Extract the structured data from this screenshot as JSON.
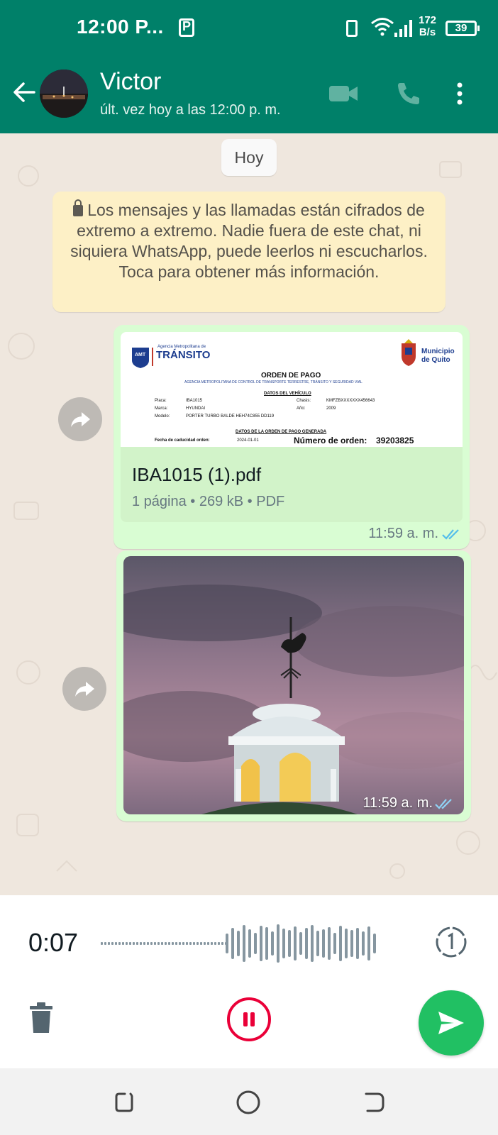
{
  "status_bar": {
    "time": "12:00 P...",
    "net_rate_value": "172",
    "net_rate_unit": "B/s",
    "battery": "39",
    "icons": [
      "p-app-icon",
      "vibrate-icon",
      "wifi-icon",
      "signal-icon",
      "battery-icon"
    ]
  },
  "header": {
    "contact_name": "Victor",
    "last_seen": "últ. vez hoy a las 12:00 p. m.",
    "icons": [
      "back-arrow-icon",
      "video-call-icon",
      "voice-call-icon",
      "more-options-icon"
    ]
  },
  "chat": {
    "date_chip": "Hoy",
    "encryption_notice": "Los mensajes y las llamadas están cifrados de extremo a extremo. Nadie fuera de este chat, ni siquiera WhatsApp, puede leerlos ni escucharlos. Toca para obtener más información.",
    "messages": [
      {
        "type": "document",
        "file_name": "IBA1015 (1).pdf",
        "meta": "1 página • 269 kB • PDF",
        "time": "11:59 a. m.",
        "status": "read",
        "preview": {
          "agency_small": "Agencia Metropolitana de",
          "agency_big": "TRÁNSITO",
          "municipio_line1": "Municipio",
          "municipio_line2": "de Quito",
          "title": "ORDEN DE PAGO",
          "subtitle": "AGENCIA METROPOLITANA DE CONTROL DE TRANSPORTE TERRESTRE, TRÁNSITO Y SEGURIDAD VIAL",
          "section_vehicle": "DATOS DEL VEHÍCULO",
          "placa_label": "Placa:",
          "placa": "IBA1015",
          "chasis_label": "Chasis:",
          "chasis": "KMFZBXXXXXXX456643",
          "marca_label": "Marca:",
          "marca": "HYUNDAI",
          "anio_label": "Año:",
          "anio": "2009",
          "modelo_label": "Modelo:",
          "modelo": "PORTER TURBO BALDE HEH74C855 DD119",
          "section_order": "DATOS DE LA ORDEN DE PAGO GENERADA",
          "caducidad_label": "Fecha de caducidad orden:",
          "caducidad": "2024-01-01",
          "orden_label": "Número de orden:",
          "orden": "39203825"
        }
      },
      {
        "type": "image",
        "description": "weathervane-dome-photo",
        "time": "11:59 a. m.",
        "status": "read"
      }
    ]
  },
  "recorder": {
    "elapsed": "0:07",
    "icons": [
      "view-once-icon",
      "trash-icon",
      "pause-icon",
      "send-icon"
    ]
  },
  "nav": {
    "icons": [
      "recents-icon",
      "home-icon",
      "back-icon"
    ]
  },
  "colors": {
    "header": "#008069",
    "bubble_out": "#d9fdd3",
    "encrypt_bg": "#fdf0c6",
    "pause": "#ea0038",
    "send": "#21c063",
    "tick_read": "#53bdeb"
  }
}
